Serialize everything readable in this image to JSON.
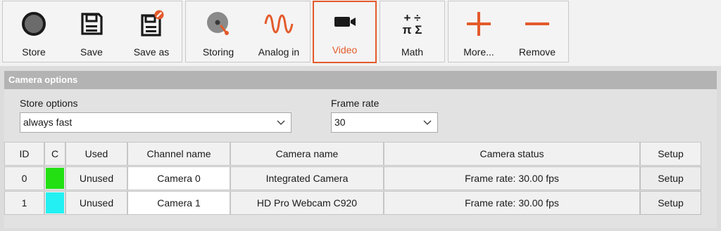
{
  "toolbar": {
    "store": "Store",
    "save": "Save",
    "save_as": "Save as",
    "storing": "Storing",
    "analog_in": "Analog in",
    "video": "Video",
    "math": "Math",
    "more": "More...",
    "remove": "Remove",
    "math_symbols_top": "+ ÷",
    "math_symbols_bottom": "π Σ"
  },
  "panel": {
    "title": "Camera options",
    "store_options_label": "Store options",
    "store_options_value": "always fast",
    "frame_rate_label": "Frame rate",
    "frame_rate_value": "30"
  },
  "table": {
    "headers": [
      "ID",
      "C",
      "Used",
      "Channel name",
      "Camera name",
      "Camera status",
      "Setup"
    ],
    "rows": [
      {
        "id": "0",
        "color": "#22e012",
        "used": "Unused",
        "channel": "Camera 0",
        "camera": "Integrated Camera",
        "status": "Frame rate: 30.00 fps",
        "setup": "Setup"
      },
      {
        "id": "1",
        "color": "#22f0f2",
        "used": "Unused",
        "channel": "Camera 1",
        "camera": "HD Pro Webcam C920",
        "status": "Frame rate: 30.00 fps",
        "setup": "Setup"
      }
    ]
  },
  "colors": {
    "accent": "#e35a2b",
    "header_bg": "#b3b3b3"
  }
}
